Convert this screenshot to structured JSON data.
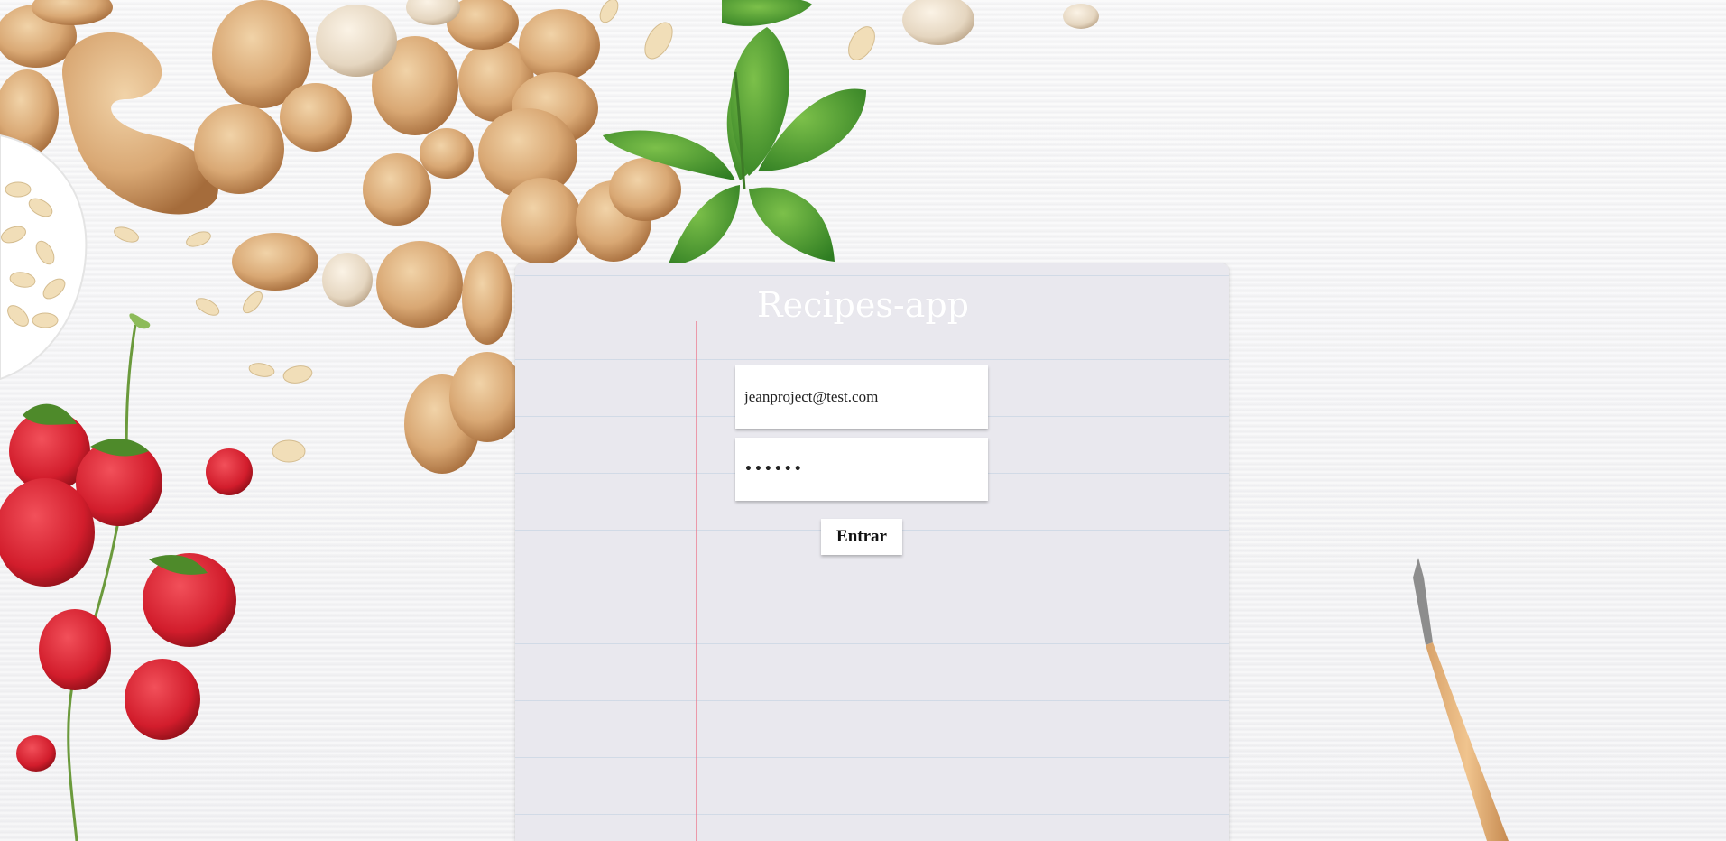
{
  "app": {
    "title": "Recipes-app"
  },
  "login": {
    "email_value": "jeanproject@test.com",
    "password_value": "••••••",
    "submit_label": "Entrar"
  },
  "decor": {
    "background": "kitchen table with nuts, garlic, basil, strawberries and a pencil",
    "icons": [
      "garlic-icon",
      "nut-icon",
      "basil-icon",
      "strawberry-icon",
      "pencil-icon",
      "notebook-icon"
    ]
  },
  "colors": {
    "title": "#ffffff",
    "button_bg": "#ffffff",
    "page_bg": "#f3f3f4"
  }
}
